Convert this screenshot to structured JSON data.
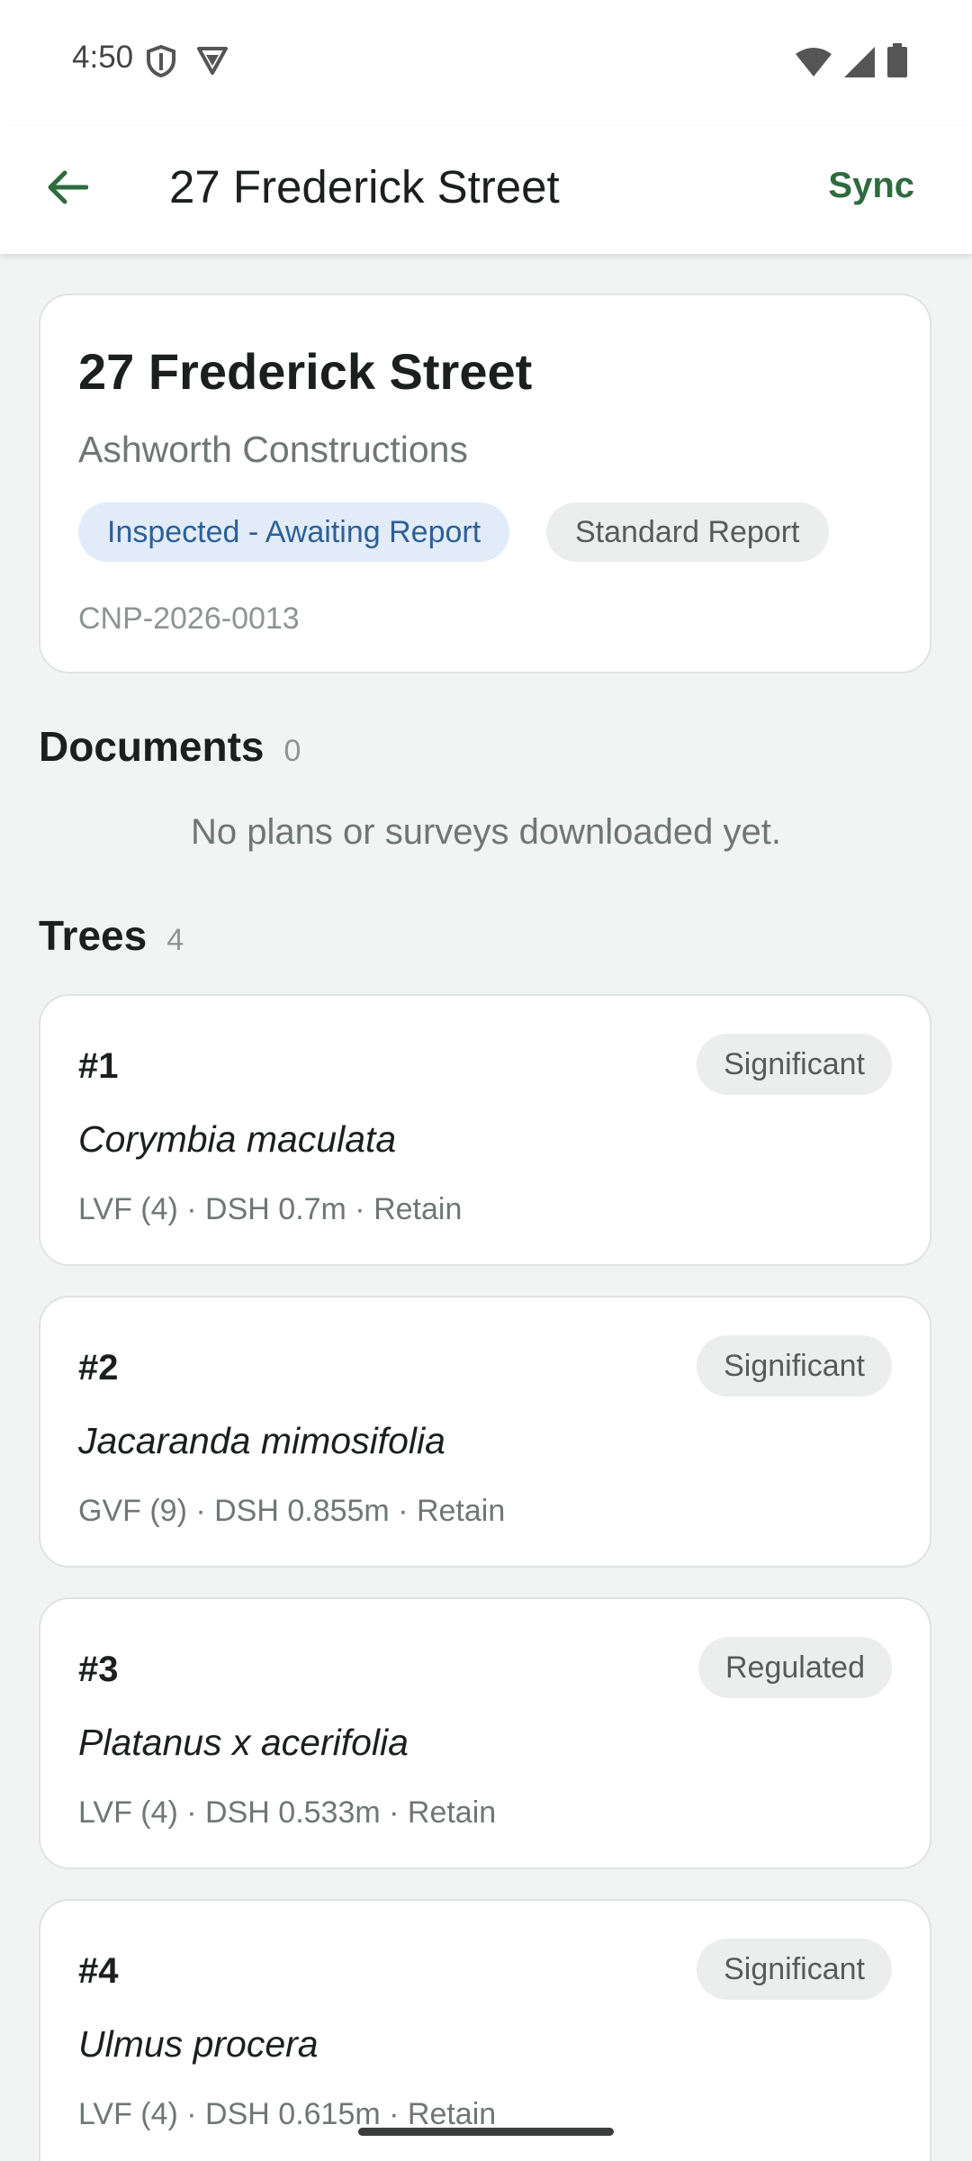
{
  "status_bar": {
    "time": "4:50",
    "icons": [
      "shield-icon",
      "vpn-icon",
      "wifi-icon",
      "signal-icon",
      "battery-icon"
    ]
  },
  "app_bar": {
    "back_icon": "arrow-left-icon",
    "title": "27 Frederick Street",
    "sync_label": "Sync"
  },
  "header_card": {
    "title": "27 Frederick Street",
    "client": "Ashworth Constructions",
    "status_chip": "Inspected - Awaiting Report",
    "report_chip": "Standard Report",
    "reference": "CNP-2026-0013"
  },
  "documents": {
    "heading": "Documents",
    "count": "0",
    "empty_message": "No plans or surveys downloaded yet."
  },
  "trees": {
    "heading": "Trees",
    "count": "4",
    "items": [
      {
        "number": "#1",
        "badge": "Significant",
        "species": "Corymbia maculata",
        "meta": "LVF (4) · DSH 0.7m · Retain"
      },
      {
        "number": "#2",
        "badge": "Significant",
        "species": "Jacaranda mimosifolia",
        "meta": "GVF (9) · DSH 0.855m · Retain"
      },
      {
        "number": "#3",
        "badge": "Regulated",
        "species": "Platanus x acerifolia",
        "meta": "LVF (4) · DSH 0.533m · Retain"
      },
      {
        "number": "#4",
        "badge": "Significant",
        "species": "Ulmus procera",
        "meta": "LVF (4) · DSH 0.615m · Retain"
      }
    ]
  },
  "colors": {
    "accent": "#2e6b3e",
    "status_chip_bg": "#e1ecf8",
    "status_chip_text": "#2e5f96",
    "background": "#f2f4f3"
  }
}
